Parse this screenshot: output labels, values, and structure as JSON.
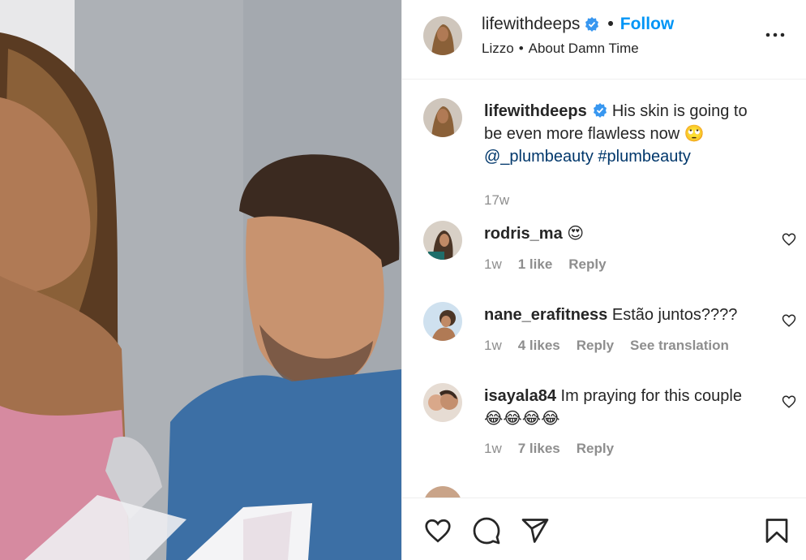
{
  "post": {
    "username": "lifewithdeeps",
    "follow_label": "Follow",
    "audio_artist": "Lizzo",
    "audio_title": "About Damn Time",
    "caption_text": "His skin is going to be even more flawless now 🙄",
    "caption_mention": "@_plumbeauty",
    "caption_hashtag": "#plumbeauty",
    "caption_time": "17w"
  },
  "comments": [
    {
      "username": "rodris_ma",
      "text": "😍",
      "time": "1w",
      "likes": "1 like",
      "reply": "Reply"
    },
    {
      "username": "nane_erafitness",
      "text": "Estão juntos????",
      "time": "1w",
      "likes": "4 likes",
      "reply": "Reply",
      "translate": "See translation"
    },
    {
      "username": "isayala84",
      "text": "Im praying for this couple 😂😂😂😂",
      "time": "1w",
      "likes": "7 likes",
      "reply": "Reply"
    }
  ],
  "colors": {
    "accent": "#0095f6",
    "link": "#00376b",
    "muted": "#8e8e8e",
    "verified": "#3897f0"
  },
  "icons": [
    "verified-badge-icon",
    "more-options-icon",
    "heart-icon",
    "comment-icon",
    "share-icon",
    "bookmark-icon"
  ]
}
